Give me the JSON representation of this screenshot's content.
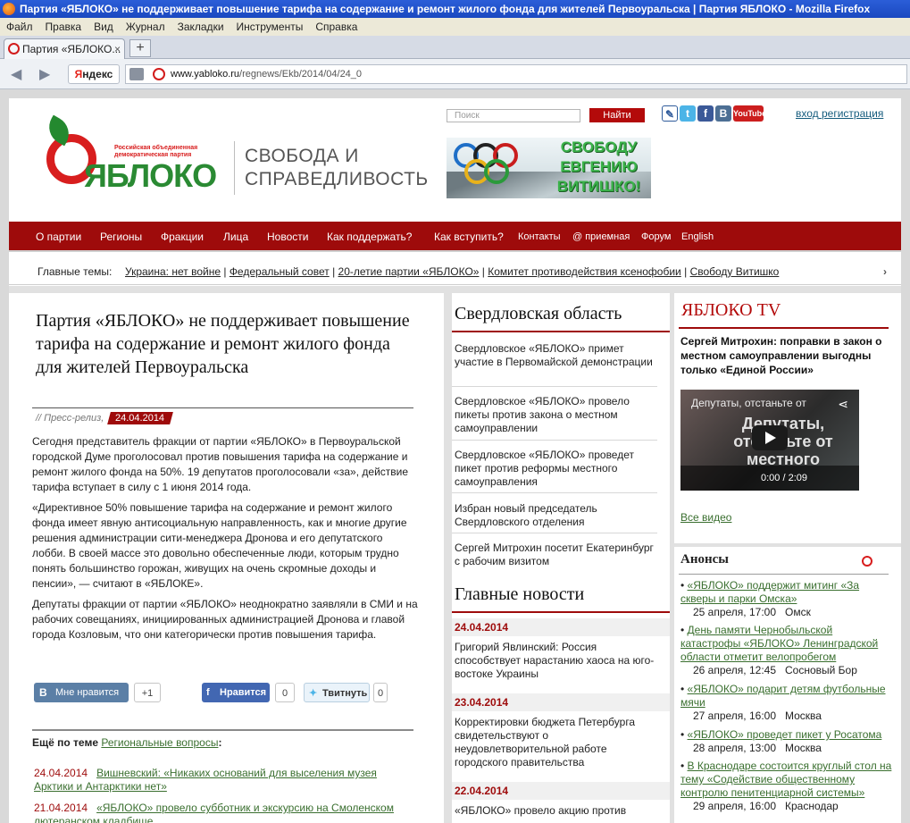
{
  "window": {
    "title": "Партия «ЯБЛОКО» не поддерживает повышение тарифа на содержание и ремонт жилого фонда для жителей Первоуральска | Партия ЯБЛОКО - Mozilla Firefox"
  },
  "menu": [
    "Файл",
    "Правка",
    "Вид",
    "Журнал",
    "Закладки",
    "Инструменты",
    "Справка"
  ],
  "tab": {
    "label": "Партия «ЯБЛОКО...",
    "close": "×",
    "new": "+"
  },
  "nav": {
    "yandex_prefix": "Я",
    "yandex_rest": "ндекс",
    "url_domain": "www.yabloko.ru",
    "url_path": "/regnews/Ekb/2014/04/24_0"
  },
  "header": {
    "search_placeholder": "Поиск",
    "search_button": "Найти",
    "login": "вход",
    "register": "регистрация",
    "logo_word": "ЯБЛОКО",
    "logo_caption": "Российская объединенная демократическая партия",
    "slogan_1": "СВОБОДА И",
    "slogan_2": "СПРАВЕДЛИВОСТЬ",
    "banner_1": "СВОБОДУ",
    "banner_2": "ЕВГЕНИЮ",
    "banner_3": "ВИТИШКО!",
    "social": {
      "fb": "f",
      "vk": "B",
      "yt": "YouTube"
    }
  },
  "mainnav": [
    "О партии",
    "Регионы",
    "Фракции",
    "Лица",
    "Новости",
    "Как поддержать?",
    "Как вступить?",
    "Контакты",
    "@ приемная",
    "Форум",
    "English"
  ],
  "topics": {
    "label": "Главные темы:",
    "items": [
      "Украина: нет войне",
      "Федеральный совет",
      "20-летие партии «ЯБЛОКО»",
      "Комитет противодействия ксенофобии",
      "Свободу Витишко"
    ],
    "arrow": "›"
  },
  "article": {
    "title": "Партия «ЯБЛОКО» не поддерживает повышение тарифа на содержание и ремонт жилого фонда для жителей Первоуральска",
    "meta": "// Пресс-релиз,",
    "date": "24.04.2014",
    "p1": "Сегодня представитель фракции от партии «ЯБЛОКО» в Первоуральской городской Думе проголосовал против повышения тарифа на содержание и ремонт жилого фонда на 50%. 19 депутатов проголосовали «за», действие тарифа вступает в силу с 1 июня 2014 года.",
    "p2": "«Директивное 50% повышение тарифа на содержание и ремонт жилого фонда имеет явную антисоциальную направленность, как и многие другие решения администрации сити-менеджера Дронова и его депутатского лобби. В своей массе это довольно обеспеченные люди, которым трудно понять большинство горожан, живущих на очень скромные доходы и пенсии», — считают в «ЯБЛОКЕ».",
    "p3": "Депутаты фракции от партии «ЯБЛОКО» неоднократно заявляли в СМИ и на рабочих совещаниях, инициированных администрацией Дронова и главой города Козловым, что они категорически против повышения тарифа.",
    "share": {
      "vk_icon": "B",
      "vk_label": "Мне нравится",
      "vk_count": "+1",
      "fb_label": "Нравится",
      "fb_count": "0",
      "tw_label": "Твитнуть",
      "tw_count": "0"
    },
    "more_label": "Ещё по теме",
    "more_link": "Региональные вопросы",
    "more_colon": ":",
    "related": [
      {
        "date": "24.04.2014",
        "text": "Вишневский: «Никаких оснований для выселения музея Арктики и Антарктики нет»"
      },
      {
        "date": "21.04.2014",
        "text": "«ЯБЛОКО» провело субботник и экскурсию на Смоленском лютеранском кладбище"
      }
    ]
  },
  "region": {
    "title": "Свердловская область",
    "items": [
      "Свердловское «ЯБЛОКО» примет участие в Первомайской демонстрации",
      "Свердловское «ЯБЛОКО» провело пикеты против закона о местном самоуправлении",
      "Свердловское «ЯБЛОКО» проведет пикет против реформы местного самоуправления",
      "Избран новый председатель Свердловского отделения",
      "Сергей Митрохин посетит Екатеринбург с рабочим визитом"
    ]
  },
  "news": {
    "title": "Главные новости",
    "groups": [
      {
        "date": "24.04.2014",
        "text": "Григорий Явлинский: Россия способствует нарастанию хаоса на юго-востоке Украины"
      },
      {
        "date": "23.04.2014",
        "text": "Корректировки бюджета Петербурга свидетельствуют о неудовлетворительной работе городского правительства"
      },
      {
        "date": "22.04.2014",
        "text": "«ЯБЛОКО» провело акцию против"
      }
    ]
  },
  "tv": {
    "title": "ЯБЛОКО TV",
    "headline": "Сергей Митрохин: поправки в закон о местном самоуправлении выгодны только «Единой России»",
    "video_title": "Депутаты, отстаньте от",
    "video_overlay": "Депутаты, отстаньте от местного",
    "video_time": "0:00 / 2:09",
    "all_video": "Все видео"
  },
  "anons": {
    "title": "Анонсы",
    "items": [
      {
        "text": "«ЯБЛОКО» поддержит митинг «За скверы и парки Омска»",
        "when": "25 апреля, 17:00",
        "place": "Омск"
      },
      {
        "text": "День памяти Чернобыльской катастрофы «ЯБЛОКО» Ленинградской области отметит велопробегом",
        "when": "26 апреля, 12:45",
        "place": "Сосновый Бор"
      },
      {
        "text": "«ЯБЛОКО» подарит детям футбольные мячи",
        "when": "27 апреля, 16:00",
        "place": "Москва"
      },
      {
        "text": "«ЯБЛОКО» проведет пикет у Росатома",
        "when": "28 апреля, 13:00",
        "place": "Москва"
      },
      {
        "text": "В Краснодаре состоится круглый стол на тему «Содействие общественному контролю пенитенциарной системы»",
        "when": "29 апреля, 16:00",
        "place": "Краснодар"
      }
    ]
  }
}
